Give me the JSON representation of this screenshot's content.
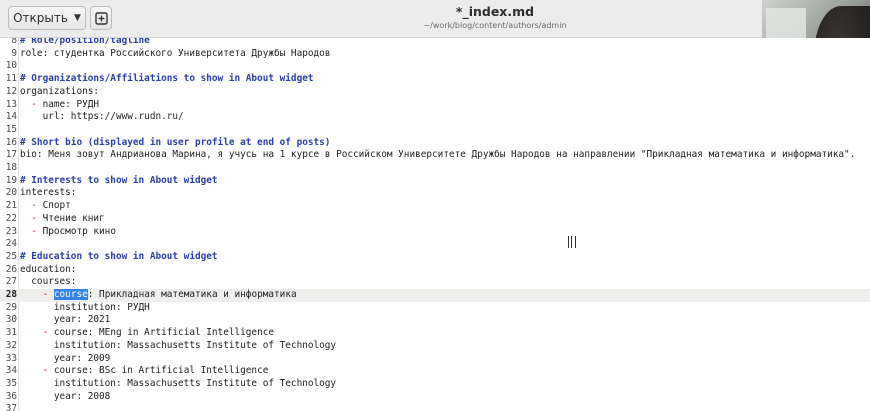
{
  "header": {
    "open_label": "Открыть",
    "title": "*_index.md",
    "subtitle": "~/work/blog/content/authors/admin"
  },
  "icons": {
    "new_document": "new-document-icon",
    "dropdown": "chevron-down-icon"
  },
  "colors": {
    "comment": "#2a3fa7",
    "dash": "#c01c28",
    "selection": "#3584e4",
    "current_line": "#eeeeec"
  },
  "editor": {
    "current_line": 28,
    "lines": [
      {
        "n": "8",
        "segs": [
          {
            "t": "# Role/position/tagline",
            "c": "comment"
          }
        ]
      },
      {
        "n": "9",
        "segs": [
          {
            "t": "role: студентка Российского Университета Дружбы Народов"
          }
        ]
      },
      {
        "n": "10",
        "segs": []
      },
      {
        "n": "11",
        "segs": [
          {
            "t": "# Organizations/Affiliations to show in About widget",
            "c": "comment"
          }
        ]
      },
      {
        "n": "12",
        "segs": [
          {
            "t": "organizations:"
          }
        ]
      },
      {
        "n": "13",
        "segs": [
          {
            "t": "  "
          },
          {
            "t": "-",
            "c": "dash"
          },
          {
            "t": " name: РУДН"
          }
        ]
      },
      {
        "n": "14",
        "segs": [
          {
            "t": "    url: https://www.rudn.ru/"
          }
        ]
      },
      {
        "n": "15",
        "segs": []
      },
      {
        "n": "16",
        "segs": [
          {
            "t": "# Short bio (displayed in user profile at end of posts)",
            "c": "comment"
          }
        ]
      },
      {
        "n": "17",
        "segs": [
          {
            "t": "bio: Меня зовут Андрианова Марина, я учусь на 1 курсе в Российском Университете Дружбы Народов на направлении \"Прикладная математика и информатика\"."
          }
        ]
      },
      {
        "n": "18",
        "segs": []
      },
      {
        "n": "19",
        "segs": [
          {
            "t": "# Interests to show in About widget",
            "c": "comment"
          }
        ]
      },
      {
        "n": "20",
        "segs": [
          {
            "t": "interests:"
          }
        ]
      },
      {
        "n": "21",
        "segs": [
          {
            "t": "  "
          },
          {
            "t": "-",
            "c": "dash"
          },
          {
            "t": " Спорт"
          }
        ]
      },
      {
        "n": "22",
        "segs": [
          {
            "t": "  "
          },
          {
            "t": "-",
            "c": "dash"
          },
          {
            "t": " Чтение книг"
          }
        ]
      },
      {
        "n": "23",
        "segs": [
          {
            "t": "  "
          },
          {
            "t": "-",
            "c": "dash"
          },
          {
            "t": " Просмотр кино"
          }
        ]
      },
      {
        "n": "24",
        "segs": []
      },
      {
        "n": "25",
        "segs": [
          {
            "t": "# Education to show in About widget",
            "c": "comment"
          }
        ]
      },
      {
        "n": "26",
        "segs": [
          {
            "t": "education:"
          }
        ]
      },
      {
        "n": "27",
        "segs": [
          {
            "t": "  courses:"
          }
        ]
      },
      {
        "n": "28",
        "segs": [
          {
            "t": "    "
          },
          {
            "t": "-",
            "c": "dash"
          },
          {
            "t": " "
          },
          {
            "t": "course",
            "c": "sel"
          },
          {
            "t": ": Прикладная математика и информатика"
          }
        ]
      },
      {
        "n": "29",
        "segs": [
          {
            "t": "      institution: РУДН"
          }
        ]
      },
      {
        "n": "30",
        "segs": [
          {
            "t": "      year: 2021"
          }
        ]
      },
      {
        "n": "31",
        "segs": [
          {
            "t": "    "
          },
          {
            "t": "-",
            "c": "dash"
          },
          {
            "t": " course: MEng in Artificial Intelligence"
          }
        ]
      },
      {
        "n": "32",
        "segs": [
          {
            "t": "      institution: Massachusetts Institute of Technology"
          }
        ]
      },
      {
        "n": "33",
        "segs": [
          {
            "t": "      year: 2009"
          }
        ]
      },
      {
        "n": "34",
        "segs": [
          {
            "t": "    "
          },
          {
            "t": "-",
            "c": "dash"
          },
          {
            "t": " course: BSc in Artificial Intelligence"
          }
        ]
      },
      {
        "n": "35",
        "segs": [
          {
            "t": "      institution: Massachusetts Institute of Technology"
          }
        ]
      },
      {
        "n": "36",
        "segs": [
          {
            "t": "      year: 2008"
          }
        ]
      },
      {
        "n": "37",
        "segs": []
      }
    ]
  }
}
